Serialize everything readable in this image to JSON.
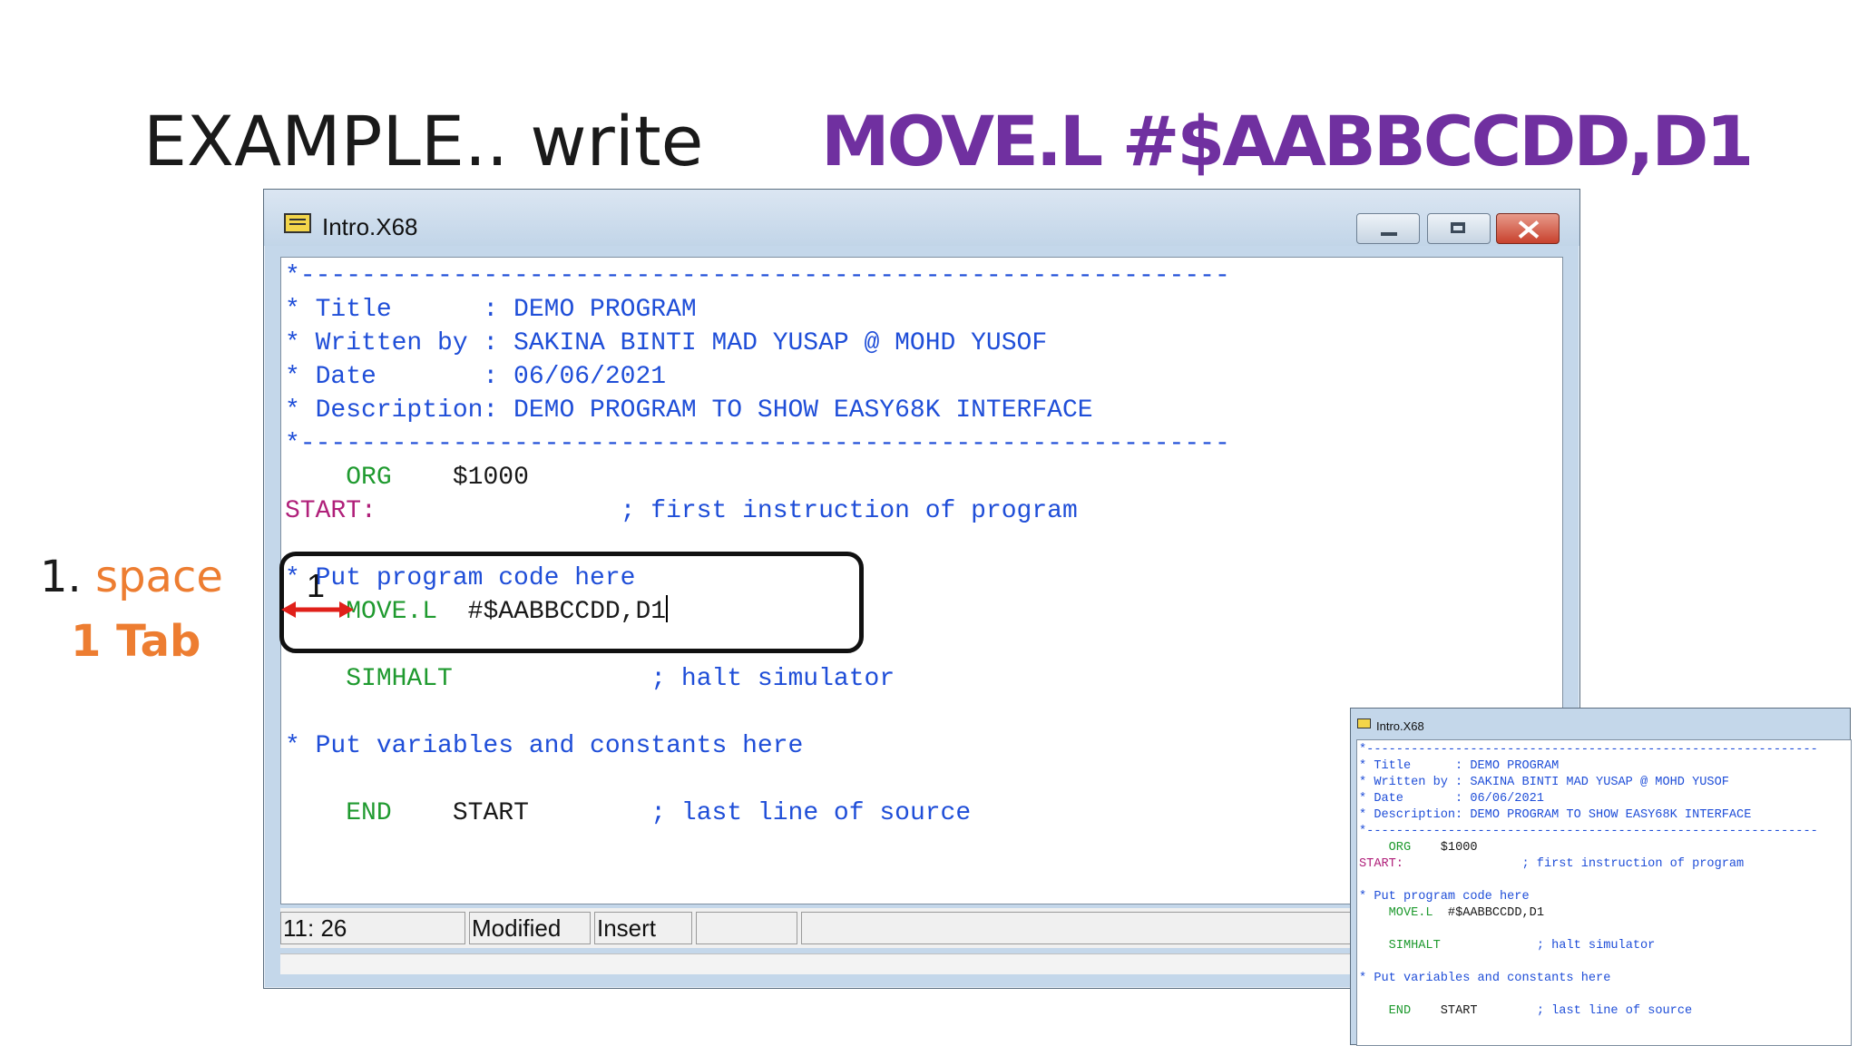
{
  "slide": {
    "heading_plain": "EXAMPLE.. write",
    "heading_code": "MOVE.L #$AABBCCDD,D1",
    "note_number": "1.",
    "note_keyword": "space",
    "note_line2": "1 Tab",
    "annotation_number": "1"
  },
  "window": {
    "title": "Intro.X68",
    "controls": [
      "minimize",
      "maximize",
      "close"
    ],
    "icon": "document-icon"
  },
  "editor": {
    "lines": [
      {
        "c": "*-------------------------------------------------------------"
      },
      {
        "c": "* Title      : DEMO PROGRAM"
      },
      {
        "c": "* Written by : SAKINA BINTI MAD YUSAP @ MOHD YUSOF"
      },
      {
        "c": "* Date       : 06/06/2021"
      },
      {
        "c": "* Description: DEMO PROGRAM TO SHOW EASY68K INTERFACE"
      },
      {
        "c": "*-------------------------------------------------------------"
      },
      {
        "pad": "    ",
        "op": "ORG",
        "gap": "    ",
        "arg": "$1000"
      },
      {
        "lbl": "START:",
        "gap": "                ",
        "c": "; first instruction of program"
      },
      {},
      {
        "c": "* Put program code here"
      },
      {
        "pad": "    ",
        "op": "MOVE.L",
        "gap": "  ",
        "arg": "#$AABBCCDD,D1",
        "caret": true
      },
      {},
      {
        "pad": "    ",
        "op": "SIMHALT",
        "gap": "             ",
        "c": "; halt simulator"
      },
      {},
      {
        "c": "* Put variables and constants here"
      },
      {},
      {
        "pad": "    ",
        "op": "END",
        "gap": "    ",
        "arg": "START",
        "gap2": "        ",
        "c": "; last line of source"
      }
    ]
  },
  "statusbar": {
    "position": "11: 26",
    "modified": "Modified",
    "mode": "Insert",
    "empty_panel": ""
  },
  "colors": {
    "heading_code": "#7030a0",
    "note_keyword": "#ed7d31",
    "comment": "#1f4ed8",
    "opcode": "#1f9a2f",
    "label": "#b0207a",
    "arrow": "#e0201a"
  }
}
